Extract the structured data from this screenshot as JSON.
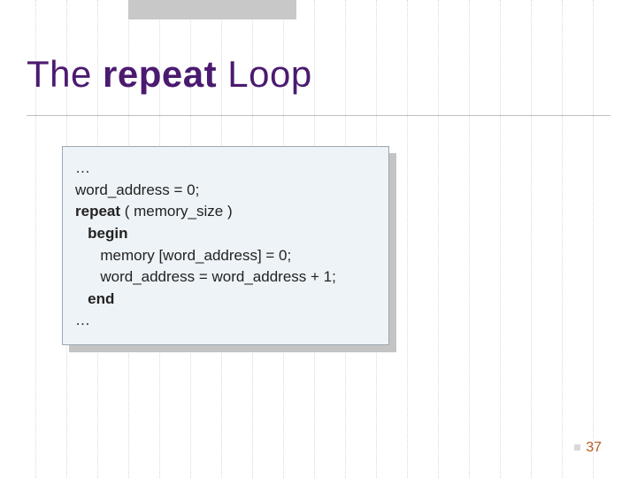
{
  "title": {
    "prefix": "The ",
    "bold": "repeat",
    "suffix": " Loop"
  },
  "code": {
    "l0": "…",
    "l1": "word_address = 0;",
    "l2a": "repeat",
    "l2b": " ( memory_size )",
    "l3": "begin",
    "l4": "memory [word_address] = 0;",
    "l5": "word_address = word_address + 1;",
    "l6": "end",
    "l7": "…"
  },
  "page_number": "37"
}
